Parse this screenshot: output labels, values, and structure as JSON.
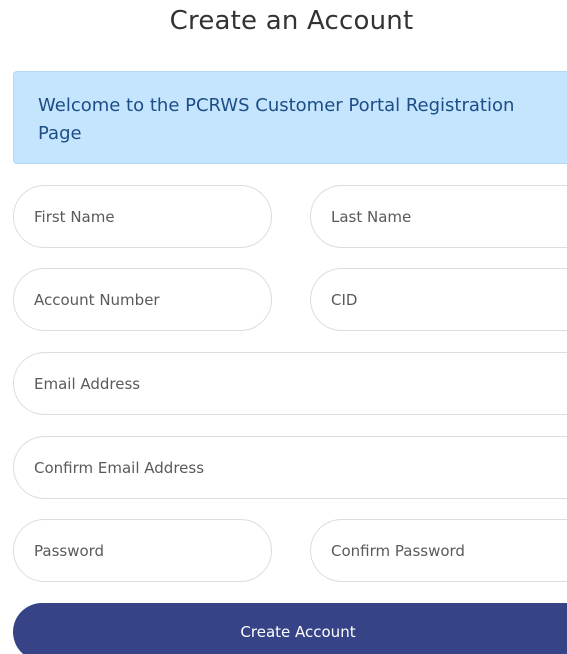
{
  "page": {
    "title": "Create an Account"
  },
  "banner": {
    "text": "Welcome to the PCRWS Customer Portal Registration Page"
  },
  "form": {
    "first_name": {
      "placeholder": "First Name",
      "value": ""
    },
    "last_name": {
      "placeholder": "Last Name",
      "value": ""
    },
    "account_number": {
      "placeholder": "Account Number",
      "value": ""
    },
    "cid": {
      "placeholder": "CID",
      "value": ""
    },
    "email": {
      "placeholder": "Email Address",
      "value": ""
    },
    "confirm_email": {
      "placeholder": "Confirm Email Address",
      "value": ""
    },
    "password": {
      "placeholder": "Password",
      "value": ""
    },
    "confirm_password": {
      "placeholder": "Confirm Password",
      "value": ""
    },
    "submit_label": "Create Account"
  },
  "colors": {
    "banner_background": "#c5e4fd",
    "banner_text": "#1b4d86",
    "button_background": "#364487",
    "button_text": "#ffffff"
  }
}
